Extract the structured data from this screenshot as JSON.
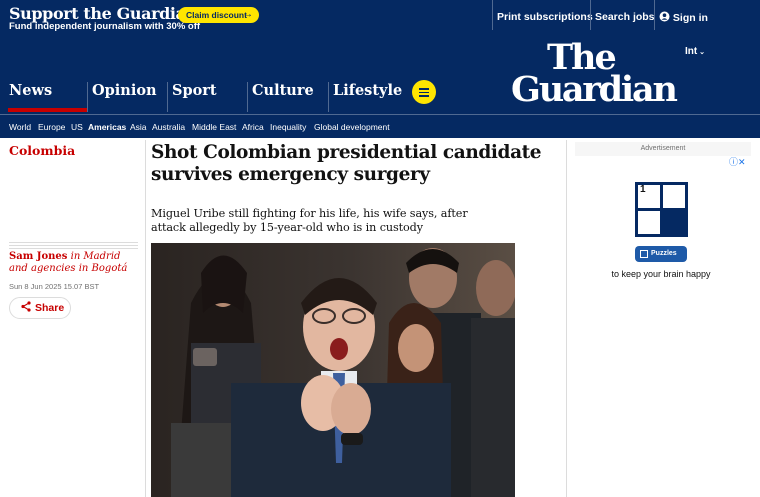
{
  "support": {
    "title": "Support the Guardian",
    "subtitle": "Fund independent journalism with 30% off",
    "cta": "Claim discount",
    "cta_arrow": "→"
  },
  "top_links": {
    "print": "Print subscriptions",
    "jobs": "Search jobs",
    "signin": "Sign in",
    "signin_icon": "user-icon"
  },
  "edition": "Int",
  "logo": {
    "line1": "The",
    "line2": "Guardian"
  },
  "pillars": [
    "News",
    "Opinion",
    "Sport",
    "Culture",
    "Lifestyle"
  ],
  "subnav": [
    "World",
    "Europe",
    "US",
    "Americas",
    "Asia",
    "Australia",
    "Middle East",
    "Africa",
    "Inequality",
    "Global development"
  ],
  "subnav_active": "Americas",
  "article": {
    "section": "Colombia",
    "headline": "Shot Colombian presidential candidate survives emergency surgery",
    "standfirst": "Miguel Uribe still fighting for his life, his wife says, after attack allegedly by 15-year-old who is in custody",
    "author": "Sam Jones",
    "location": " in Madrid and agencies in Bogotá",
    "date": "Sun 8 Jun 2025 15.07 BST",
    "share": "Share"
  },
  "ad": {
    "label": "Advertisement",
    "info": "ⓘ✕",
    "puzzle_number": "1",
    "pill": "Puzzles",
    "tagline": "to keep your brain happy"
  },
  "colors": {
    "brand": "#052962",
    "accent": "#c70000",
    "highlight": "#ffe500"
  }
}
